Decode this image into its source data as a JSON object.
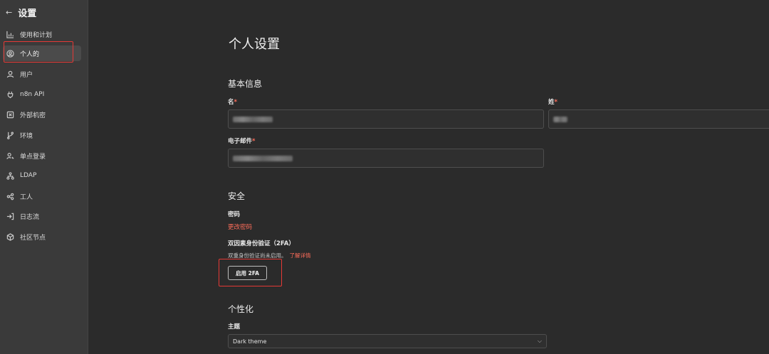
{
  "sidebar": {
    "back_glyph": "←",
    "title": "设置",
    "items": [
      {
        "label": "使用和计划",
        "icon": "bar-chart-icon"
      },
      {
        "label": "个人的",
        "icon": "user-circle-icon"
      },
      {
        "label": "用户",
        "icon": "user-icon"
      },
      {
        "label": "n8n API",
        "icon": "plug-icon"
      },
      {
        "label": "外部机密",
        "icon": "box-icon"
      },
      {
        "label": "环境",
        "icon": "git-branch-icon"
      },
      {
        "label": "单点登录",
        "icon": "user-key-icon"
      },
      {
        "label": "LDAP",
        "icon": "network-icon"
      },
      {
        "label": "工人",
        "icon": "workers-icon"
      },
      {
        "label": "日志流",
        "icon": "log-in-icon"
      },
      {
        "label": "社区节点",
        "icon": "cube-icon"
      }
    ],
    "active_index": 1
  },
  "main": {
    "title": "个人设置",
    "basic": {
      "section": "基本信息",
      "first_name_label": "名",
      "last_name_label": "姓",
      "email_label": "电子邮件",
      "required_mark": "*"
    },
    "security": {
      "section": "安全",
      "password_label": "密码",
      "change_password": "更改密码",
      "twofa_label": "双因素身份验证（2FA）",
      "twofa_note": "双重身份验证尚未启用。",
      "learn_more": "了解详情",
      "enable_button": "启用 2FA"
    },
    "personalization": {
      "section": "个性化",
      "theme_label": "主题",
      "theme_value": "Dark theme"
    }
  },
  "colors": {
    "accent": "#ff6d5a",
    "annotation": "#e53935",
    "background": "#2b2b2b",
    "sidebar": "#3a3a3a"
  }
}
